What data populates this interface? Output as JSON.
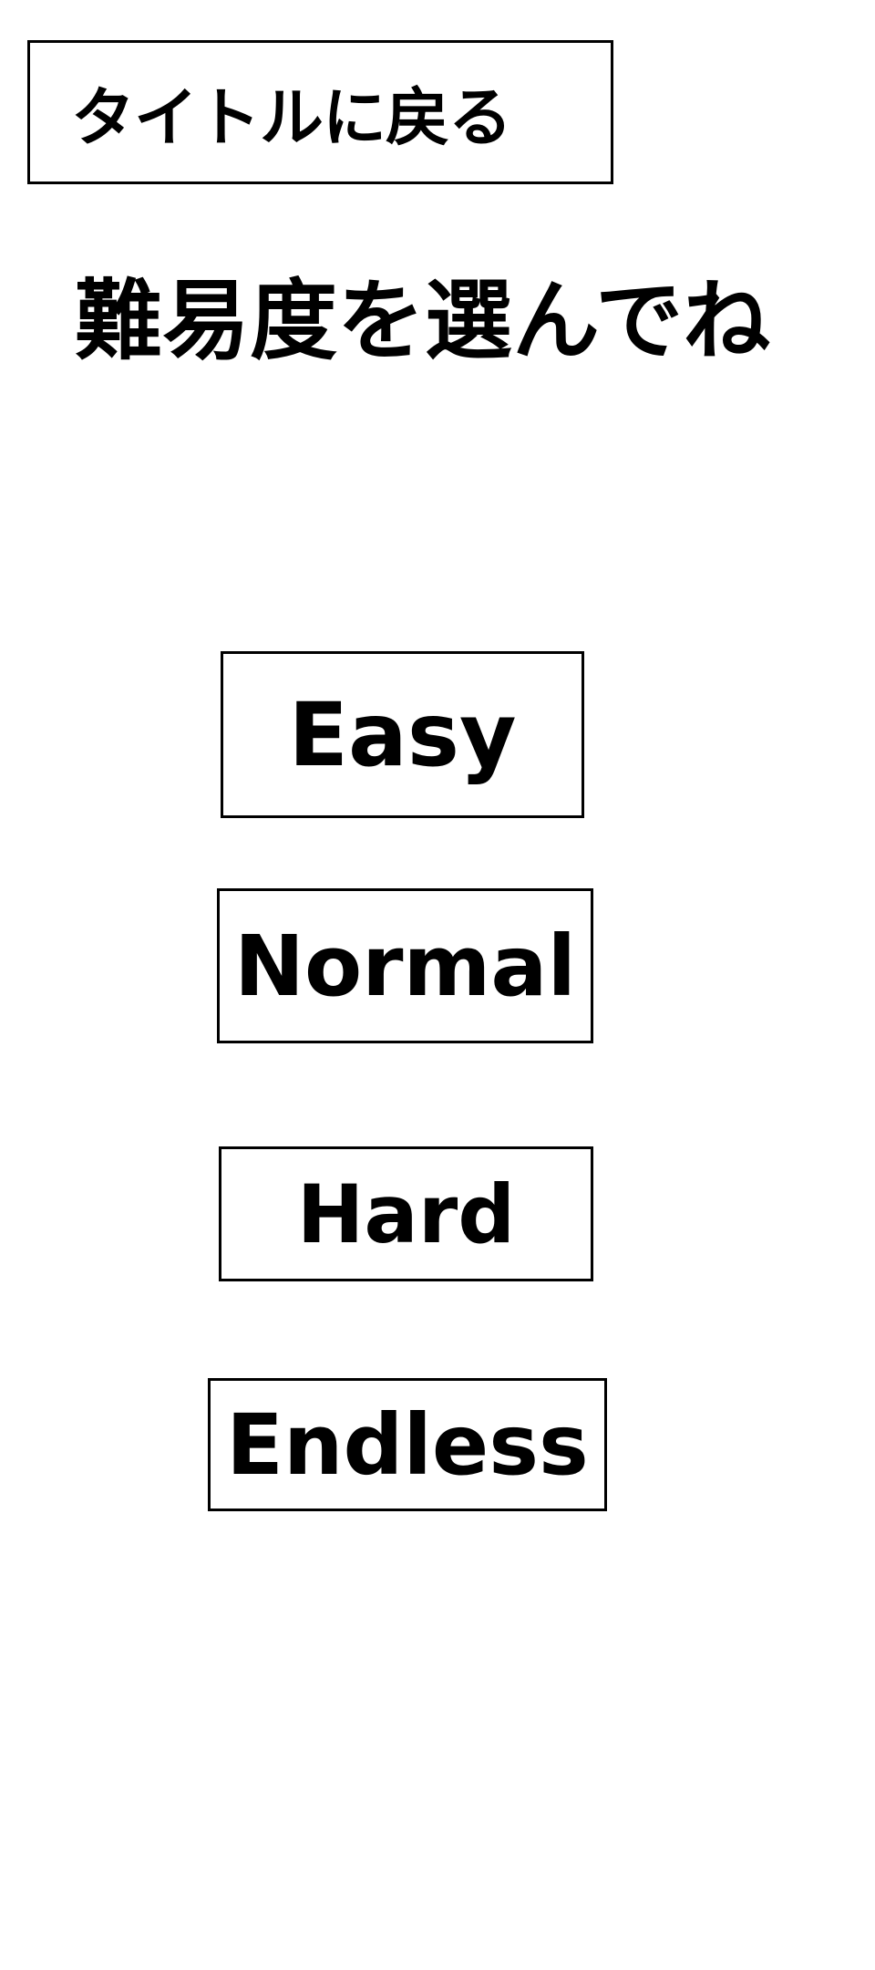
{
  "header": {
    "back_button_label": "タイトルに戻る"
  },
  "main": {
    "title": "難易度を選んでね",
    "difficulties": [
      {
        "label": "Easy"
      },
      {
        "label": "Normal"
      },
      {
        "label": "Hard"
      },
      {
        "label": "Endless"
      }
    ]
  },
  "colors": {
    "background": "#ffffff",
    "text": "#000000",
    "border": "#000000"
  }
}
